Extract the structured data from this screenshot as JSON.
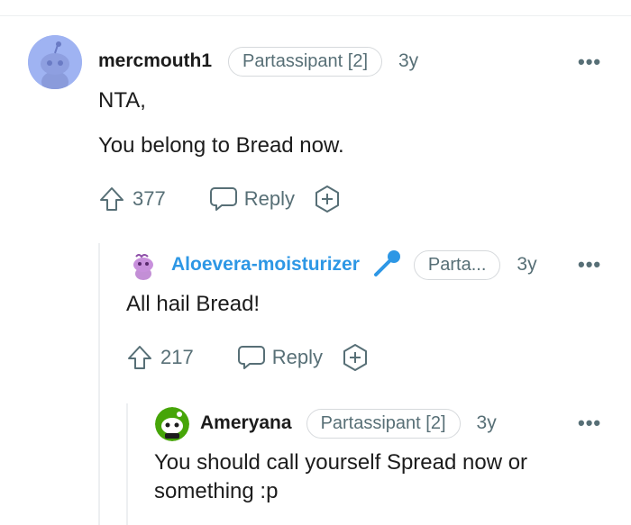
{
  "comments": [
    {
      "username": "mercmouth1",
      "flair": "Partassipant [2]",
      "age": "3y",
      "more": "•••",
      "body": [
        "NTA,",
        "You belong to Bread now."
      ],
      "votes": "377",
      "reply_label": "Reply",
      "avatar_icon": "snoo-avatar-icon",
      "color": "#1c1c1c"
    },
    {
      "username": "Aloevera-moisturizer",
      "flair": "Parta...",
      "age": "3y",
      "more": "•••",
      "body": [
        "All hail Bread!"
      ],
      "votes": "217",
      "reply_label": "Reply",
      "avatar_icon": "purple-snoo-avatar-icon",
      "username_color": "#2d97e5",
      "badge_icon": "microphone-icon"
    },
    {
      "username": "Ameryana",
      "flair": "Partassipant [2]",
      "age": "3y",
      "more": "•••",
      "body": [
        "You should call yourself Spread now or",
        "something :p"
      ],
      "avatar_icon": "green-snoo-avatar-icon"
    }
  ],
  "colors": {
    "meta": "#576f76",
    "thread_line": "#edeff1",
    "blue_name": "#2d97e5"
  }
}
